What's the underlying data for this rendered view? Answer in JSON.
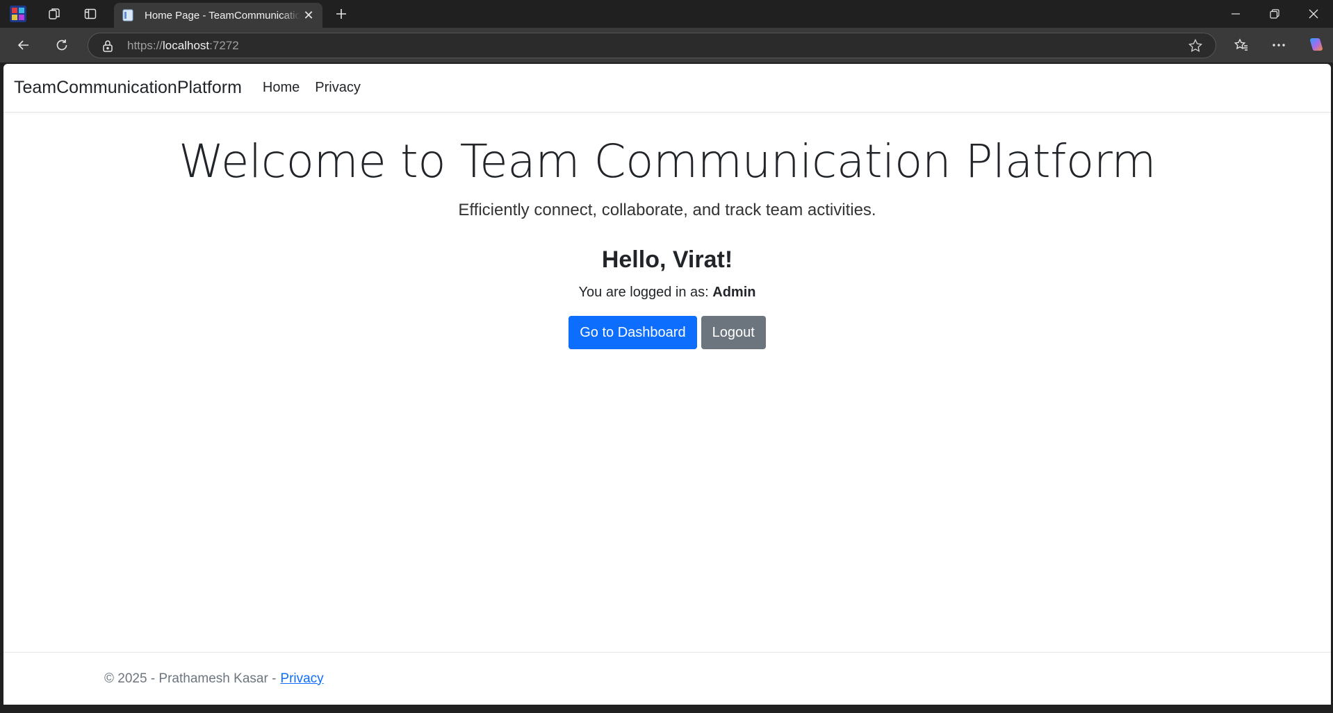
{
  "browser": {
    "tab_title": "Home Page - TeamCommunicationPlatform",
    "url_scheme": "https://",
    "url_host": "localhost",
    "url_port": ":7272"
  },
  "site": {
    "brand": "TeamCommunicationPlatform",
    "nav": [
      {
        "label": "Home"
      },
      {
        "label": "Privacy"
      }
    ]
  },
  "main": {
    "title": "Welcome to Team Communication Platform",
    "subtitle": "Efficiently connect, collaborate, and track team activities.",
    "greeting": "Hello, Virat!",
    "role_prefix": "You are logged in as:",
    "role": "Admin",
    "dashboard_button": "Go to Dashboard",
    "logout_button": "Logout"
  },
  "footer": {
    "copyright": "© 2025 - Prathamesh Kasar -",
    "privacy_link": "Privacy"
  },
  "colors": {
    "primary": "#0d6efd",
    "secondary": "#6c757d"
  }
}
